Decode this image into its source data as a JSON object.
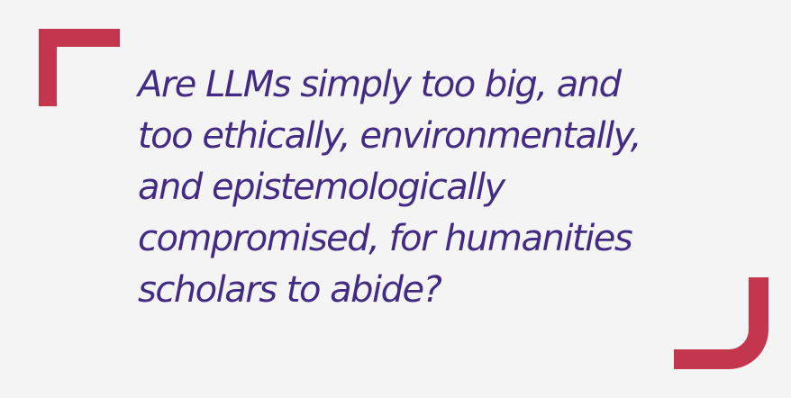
{
  "colors": {
    "background": "#f5f4f5",
    "bracket": "#c4364d",
    "text": "#432a85"
  },
  "quote": {
    "lines": [
      "Are LLMs simply too big, and",
      "too ethically, environmentally,",
      "and epistemologically",
      "compromised, for humanities",
      "scholars to abide?"
    ]
  }
}
